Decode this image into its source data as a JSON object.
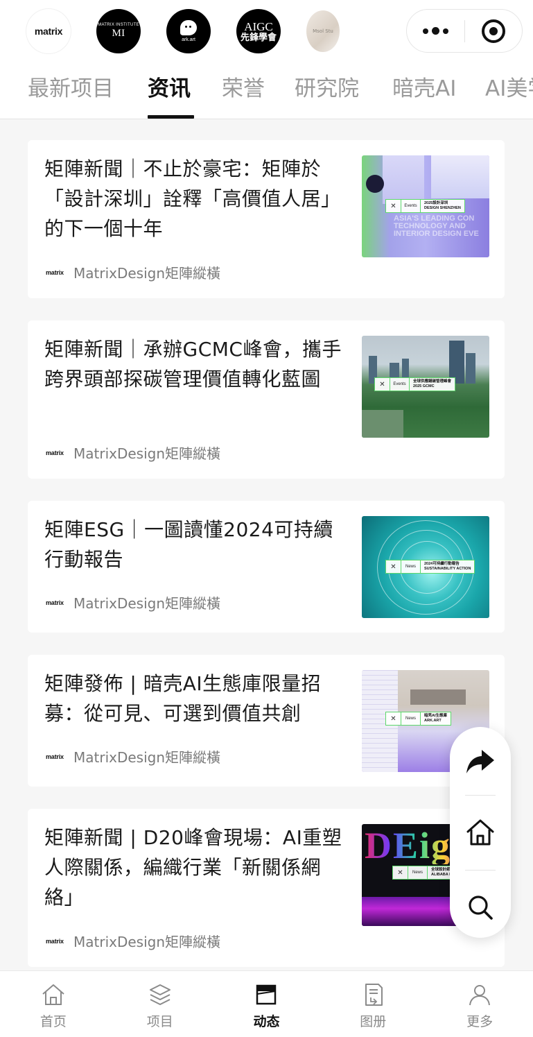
{
  "header": {
    "logos": [
      {
        "icon": "matrix-logo",
        "text": "matrix"
      },
      {
        "icon": "matrix-institute-logo",
        "text": "MATRIX INSTITUTE",
        "mark": "MI"
      },
      {
        "icon": "ark-art-logo",
        "text": "ark.art"
      },
      {
        "icon": "aigc-logo",
        "text": "AIGC",
        "subtext": "先鋒學會"
      },
      {
        "icon": "msol-studio-logo",
        "text": "Msol Stu"
      }
    ],
    "capsule": {
      "menu_icon": "more-dots-icon",
      "close_icon": "target-icon"
    }
  },
  "tabs": [
    {
      "label": "最新项目",
      "active": false
    },
    {
      "label": "资讯",
      "active": true
    },
    {
      "label": "荣誉",
      "active": false
    },
    {
      "label": "研究院",
      "active": false
    },
    {
      "label": "暗壳AI",
      "active": false
    },
    {
      "label": "AI美学",
      "active": false
    }
  ],
  "articles": [
    {
      "title": "矩陣新聞｜不止於豪宅：矩陣於「設計深圳」詮釋「高價值人居」的下一個十年",
      "source_mark": "matrix",
      "source": "MatrixDesign矩陣縱橫",
      "thumb": {
        "badge_type": "Events",
        "badge_text_1": "2025設計深圳",
        "badge_text_2": "DESIGN SHENZHEN",
        "overlay": "ASIA'S LEADING CON\nTECHNOLOGY AND\nINTERIOR DESIGN EVE"
      }
    },
    {
      "title": "矩陣新聞｜承辦GCMC峰會，攜手跨界頭部探碳管理價值轉化藍圖",
      "source_mark": "matrix",
      "source": "MatrixDesign矩陣縱橫",
      "thumb": {
        "badge_type": "Events",
        "badge_text_1": "全球供應鏈碳管理峰會",
        "badge_text_2": "2025 GCMC"
      }
    },
    {
      "title": "矩陣ESG｜一圖讀懂2024可持續行動報告",
      "source_mark": "matrix",
      "source": "MatrixDesign矩陣縱橫",
      "thumb": {
        "badge_type": "News",
        "badge_text_1": "2024可持續行動報告",
        "badge_text_2": "SUSTAINABILITY ACTION"
      }
    },
    {
      "title": "矩陣發佈 | 暗壳AI生態庫限量招募：從可見、可選到價值共創",
      "source_mark": "matrix",
      "source": "MatrixDesign矩陣縱橫",
      "thumb": {
        "badge_type": "News",
        "badge_text_1": "暗壳AI生態庫",
        "badge_text_2": "ARK.ART"
      }
    },
    {
      "title": "矩陣新聞 | D20峰會現場：AI重塑人際關係，編織行業「新關係網絡」",
      "source_mark": "matrix",
      "source": "MatrixDesign矩陣縱橫",
      "thumb": {
        "badge_type": "News",
        "badge_text_1": "全球設計師系統",
        "badge_text_2": "ALIBABA D20",
        "overlay": "DEige"
      }
    }
  ],
  "fab": {
    "items": [
      {
        "icon": "share-arrow-icon"
      },
      {
        "icon": "home-icon"
      },
      {
        "icon": "search-icon"
      }
    ]
  },
  "bottom_nav": [
    {
      "label": "首页",
      "icon": "home-icon",
      "active": false
    },
    {
      "label": "项目",
      "icon": "layers-icon",
      "active": false
    },
    {
      "label": "动态",
      "icon": "clapper-icon",
      "active": true
    },
    {
      "label": "图册",
      "icon": "album-icon",
      "active": false
    },
    {
      "label": "更多",
      "icon": "user-icon",
      "active": false
    }
  ],
  "colors": {
    "accent": "#111111",
    "inactive": "#9a9a9a",
    "badge_green": "#5cd86a",
    "background": "#f6f6f6"
  }
}
